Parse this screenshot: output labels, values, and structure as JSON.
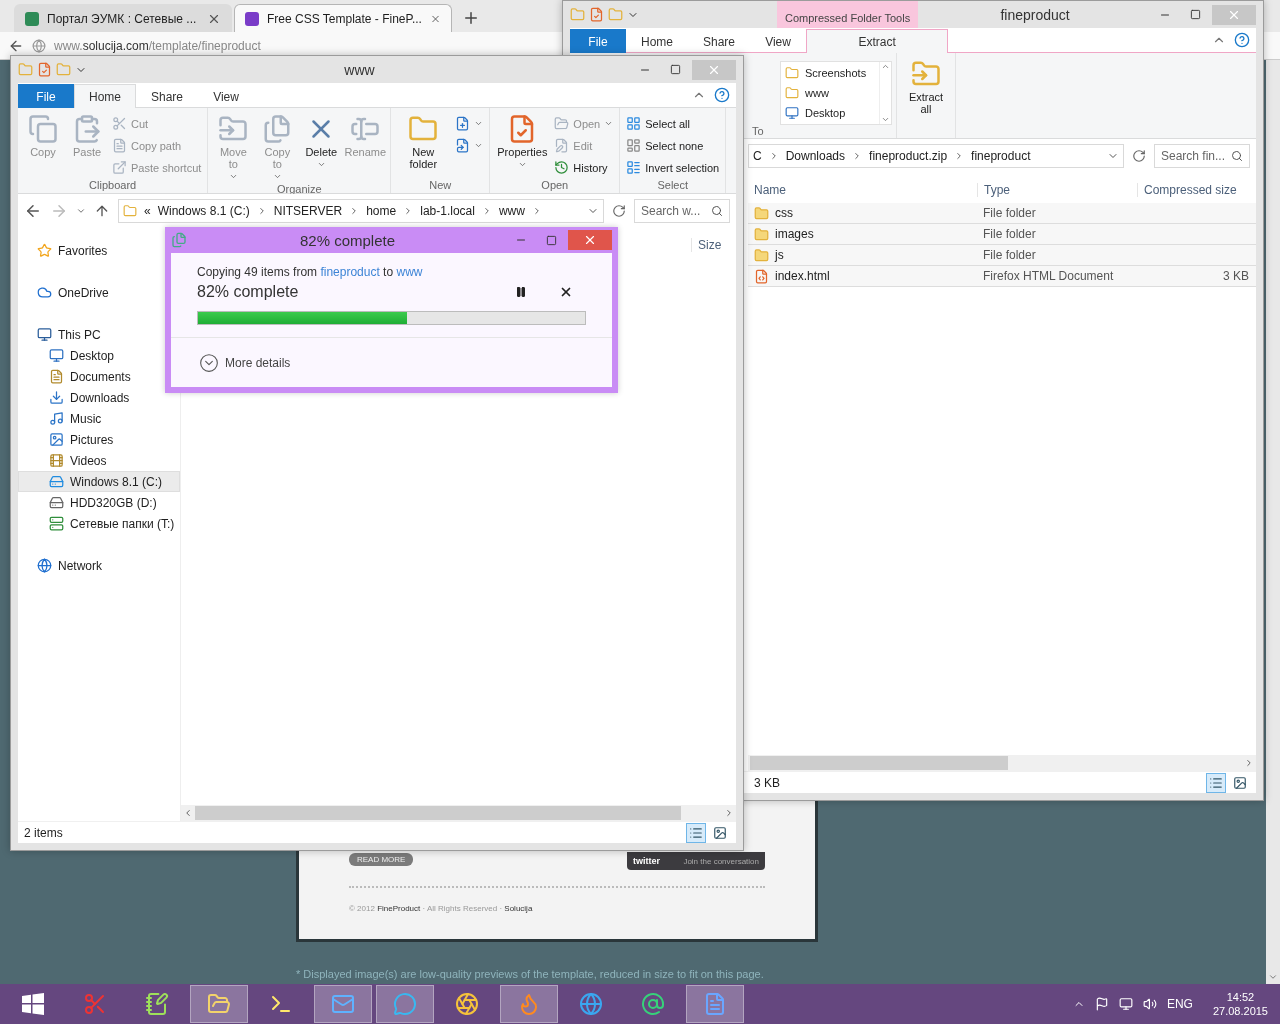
{
  "browser": {
    "tabs": [
      {
        "title": "Портал ЭУМК : Сетевые ...",
        "selected": false
      },
      {
        "title": "Free CSS Template - FineP...",
        "selected": true
      }
    ],
    "address": "www.**solucija.com**/template/fineproduct",
    "page": {
      "read_more": "READ MORE",
      "twitter_logo": "twitter",
      "twitter_caption": "Join the conversation",
      "footer": "© 2012 **FineProduct** · All Rights Reserved · **Solucija**",
      "note": "* Displayed image(s) are low-quality previews of the template, reduced in size to fit on this page."
    }
  },
  "zip_window": {
    "title": "fineproduct",
    "context_tab": "Compressed Folder Tools",
    "tabs": [
      {
        "label": "File",
        "kind": "file",
        "selected": false
      },
      {
        "label": "Home",
        "kind": "tab",
        "selected": false
      },
      {
        "label": "Share",
        "kind": "tab",
        "selected": false
      },
      {
        "label": "View",
        "kind": "tab",
        "selected": false
      },
      {
        "label": "Extract",
        "kind": "context",
        "selected": true
      }
    ],
    "extract_to": {
      "label": "To",
      "folders": [
        {
          "name": "Screenshots",
          "kind": "folder"
        },
        {
          "name": "www",
          "kind": "folder"
        },
        {
          "name": "Desktop",
          "kind": "desktop"
        }
      ]
    },
    "extract_all": "Extract all",
    "breadcrumb": [
      "C",
      "Downloads",
      "fineproduct.zip",
      "fineproduct"
    ],
    "search": {
      "placeholder": "Search fin..."
    },
    "columns": [
      "Name",
      "Type",
      "Compressed size"
    ],
    "rows": [
      {
        "name": "css",
        "kind": "folder",
        "type": "File folder"
      },
      {
        "name": "images",
        "kind": "folder",
        "type": "File folder"
      },
      {
        "name": "js",
        "kind": "folder",
        "type": "File folder"
      },
      {
        "name": "index.html",
        "kind": "file",
        "type": "Firefox HTML Document",
        "size": "3 KB"
      }
    ],
    "status": "3 KB"
  },
  "www_window": {
    "title": "www",
    "tabs": [
      {
        "label": "File",
        "kind": "file",
        "selected": false
      },
      {
        "label": "Home",
        "kind": "tab",
        "selected": true
      },
      {
        "label": "Share",
        "kind": "tab",
        "selected": false
      },
      {
        "label": "View",
        "kind": "tab",
        "selected": false
      }
    ],
    "ribbon": [
      {
        "label": "Clipboard",
        "buttons": [
          {
            "label": "Copy",
            "kind": "large",
            "disabled": true
          },
          {
            "label": "Paste",
            "kind": "large",
            "disabled": true
          },
          {
            "label": "Cut",
            "kind": "small",
            "disabled": true
          },
          {
            "label": "Copy path",
            "kind": "small",
            "disabled": true
          },
          {
            "label": "Paste shortcut",
            "kind": "small",
            "disabled": true
          }
        ]
      },
      {
        "label": "Organize",
        "buttons": [
          {
            "label": "Move to",
            "kind": "large",
            "disabled": true,
            "menu": true
          },
          {
            "label": "Copy to",
            "kind": "large",
            "disabled": true,
            "menu": true
          },
          {
            "label": "Delete",
            "kind": "large",
            "disabled": false,
            "menu": true
          },
          {
            "label": "Rename",
            "kind": "large",
            "disabled": true
          }
        ]
      },
      {
        "label": "New",
        "buttons": [
          {
            "label": "New folder",
            "kind": "large",
            "disabled": false
          },
          {
            "kind": "icon",
            "disabled": false,
            "menu": true
          },
          {
            "kind": "icon",
            "disabled": false,
            "menu": true
          }
        ]
      },
      {
        "label": "Open",
        "buttons": [
          {
            "label": "Properties",
            "kind": "large",
            "disabled": false,
            "menu": true
          },
          {
            "label": "Open",
            "kind": "small",
            "disabled": true,
            "menu": true
          },
          {
            "label": "Edit",
            "kind": "small",
            "disabled": true
          },
          {
            "label": "History",
            "kind": "small",
            "disabled": false
          }
        ]
      },
      {
        "label": "Select",
        "buttons": [
          {
            "label": "Select all",
            "kind": "small",
            "disabled": false
          },
          {
            "label": "Select none",
            "kind": "small",
            "disabled": false
          },
          {
            "label": "Invert selection",
            "kind": "small",
            "disabled": false
          }
        ]
      }
    ],
    "path_overflow": "«",
    "path": [
      "Windows 8.1 (C:)",
      "NITSERVER",
      "home",
      "lab-1.local",
      "www"
    ],
    "search": {
      "placeholder": "Search w..."
    },
    "nav": [
      {
        "label": "Favorites",
        "kind": "favorites",
        "selected": false
      },
      {
        "label": "OneDrive",
        "kind": "cloud",
        "selected": false
      },
      {
        "label": "This PC",
        "kind": "pc",
        "selected": false,
        "children": [
          {
            "label": "Desktop",
            "kind": "desktop",
            "selected": false
          },
          {
            "label": "Documents",
            "kind": "documents",
            "selected": false
          },
          {
            "label": "Downloads",
            "kind": "downloads",
            "selected": false
          },
          {
            "label": "Music",
            "kind": "music",
            "selected": false
          },
          {
            "label": "Pictures",
            "kind": "pictures",
            "selected": false
          },
          {
            "label": "Videos",
            "kind": "videos",
            "selected": false
          },
          {
            "label": "Windows 8.1 (C:)",
            "kind": "drive-os",
            "selected": true
          },
          {
            "label": "HDD320GB (D:)",
            "kind": "drive",
            "selected": false
          },
          {
            "label": "Сетевые папки (T:)",
            "kind": "network-drive",
            "selected": false
          }
        ]
      },
      {
        "label": "Network",
        "kind": "network",
        "selected": false
      }
    ],
    "columns": [
      "Size"
    ],
    "status": "2 items"
  },
  "dialog": {
    "title": "82% complete",
    "message": {
      "prefix": "Copying 49 items from",
      "source": "fineproduct",
      "joiner": "to",
      "destination": "www"
    },
    "progress_text": "82% complete",
    "level": 0.54,
    "more_details": "More details"
  },
  "taskbar": {
    "apps": [
      {
        "kind": "windows",
        "active": false
      },
      {
        "kind": "scissors",
        "active": false
      },
      {
        "kind": "notepad",
        "active": false
      },
      {
        "kind": "explorer",
        "active": true
      },
      {
        "kind": "terminal",
        "active": false
      },
      {
        "kind": "mail",
        "active": true
      },
      {
        "kind": "chat",
        "active": true
      },
      {
        "kind": "aperture",
        "active": false
      },
      {
        "kind": "flame",
        "active": true
      },
      {
        "kind": "globe",
        "active": false
      },
      {
        "kind": "at",
        "active": false
      },
      {
        "kind": "document",
        "active": true
      }
    ],
    "language": "ENG",
    "time": "14:52",
    "date": "27.08.2015"
  }
}
